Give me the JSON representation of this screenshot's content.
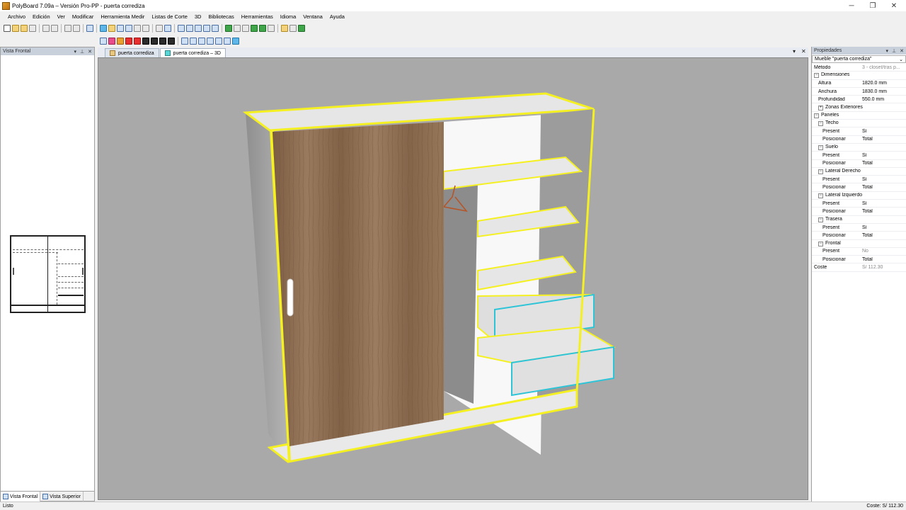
{
  "window": {
    "title": "PolyBoard 7.09a – Versión Pro-PP - puerta corrediza",
    "minimize": "─",
    "maximize": "❐",
    "close": "✕"
  },
  "menu": [
    "Archivo",
    "Edición",
    "Ver",
    "Modificar",
    "Herramienta Medir",
    "Listas de Corte",
    "3D",
    "Bibliotecas",
    "Herramientas",
    "Idioma",
    "Ventana",
    "Ayuda"
  ],
  "left_panel": {
    "title": "Vista Frontal",
    "tabs": [
      "Vista Frontal",
      "Vista Superior"
    ]
  },
  "doc_tabs": [
    "puerta corrediza",
    "puerta corrediza – 3D"
  ],
  "properties": {
    "title": "Propiedades",
    "selected": "Mueble \"puerta corrediza\"",
    "rows": [
      {
        "key": "Método",
        "value": "3 - closet/tras p...",
        "indent": 0,
        "gray": true
      },
      {
        "key": "Dimensiones",
        "indent": 0,
        "group": true,
        "toggle": "−"
      },
      {
        "key": "Altura",
        "value": "1820.0 mm",
        "indent": 2
      },
      {
        "key": "Anchura",
        "value": "1830.0 mm",
        "indent": 2
      },
      {
        "key": "Profundidad",
        "value": "550.0 mm",
        "indent": 2
      },
      {
        "key": "Zonas Exteriores",
        "indent": 2,
        "group": true,
        "toggle": "+"
      },
      {
        "key": "Paneles",
        "indent": 0,
        "group": true,
        "toggle": "−"
      },
      {
        "key": "Techo",
        "indent": 2,
        "group": true,
        "toggle": "−"
      },
      {
        "key": "Present",
        "value": "Sí",
        "indent": 4
      },
      {
        "key": "Posicionar",
        "value": "Total",
        "indent": 4
      },
      {
        "key": "Suelo",
        "indent": 2,
        "group": true,
        "toggle": "−"
      },
      {
        "key": "Present",
        "value": "Sí",
        "indent": 4
      },
      {
        "key": "Posicionar",
        "value": "Total",
        "indent": 4
      },
      {
        "key": "Lateral Derecho",
        "indent": 2,
        "group": true,
        "toggle": "−"
      },
      {
        "key": "Present",
        "value": "Sí",
        "indent": 4
      },
      {
        "key": "Posicionar",
        "value": "Total",
        "indent": 4
      },
      {
        "key": "Lateral Izquierdo",
        "indent": 2,
        "group": true,
        "toggle": "−"
      },
      {
        "key": "Present",
        "value": "Sí",
        "indent": 4
      },
      {
        "key": "Posicionar",
        "value": "Total",
        "indent": 4
      },
      {
        "key": "Trasera",
        "indent": 2,
        "group": true,
        "toggle": "−"
      },
      {
        "key": "Present",
        "value": "Sí",
        "indent": 4
      },
      {
        "key": "Posicionar",
        "value": "Total",
        "indent": 4
      },
      {
        "key": "Frontal",
        "indent": 2,
        "group": true,
        "toggle": "−"
      },
      {
        "key": "Present",
        "value": "No",
        "indent": 4,
        "gray": true
      },
      {
        "key": "Posicionar",
        "value": "Total",
        "indent": 4
      },
      {
        "key": "Coste",
        "value": "S/ 112.30",
        "indent": 0,
        "gray": true
      }
    ]
  },
  "status": {
    "left": "Listo",
    "right": "Coste: S/ 112.30"
  },
  "colors": {
    "viewport_bg": "#a9a9a9",
    "highlight_edge": "#f5f022",
    "drawer_edge": "#2ec4d8",
    "wood": "#8a6a4e"
  }
}
